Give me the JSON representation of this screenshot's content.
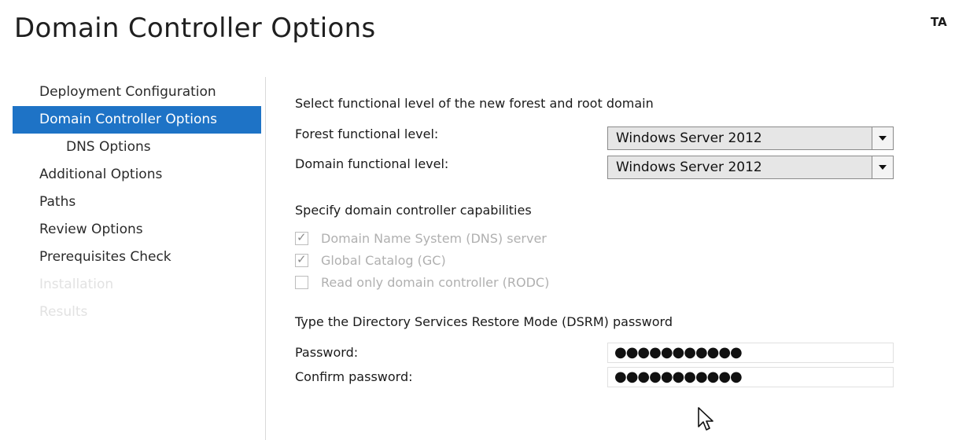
{
  "header": {
    "title": "Domain Controller Options",
    "server_badge": "TA"
  },
  "sidebar": {
    "items": [
      {
        "label": "Deployment Configuration",
        "state": "normal"
      },
      {
        "label": "Domain Controller Options",
        "state": "active"
      },
      {
        "label": "DNS Options",
        "state": "normal"
      },
      {
        "label": "Additional Options",
        "state": "normal"
      },
      {
        "label": "Paths",
        "state": "normal"
      },
      {
        "label": "Review Options",
        "state": "normal"
      },
      {
        "label": "Prerequisites Check",
        "state": "normal"
      },
      {
        "label": "Installation",
        "state": "disabled"
      },
      {
        "label": "Results",
        "state": "disabled"
      }
    ],
    "active_color": "#1e73c6"
  },
  "functional_level": {
    "heading": "Select functional level of the new forest and root domain",
    "forest_label": "Forest functional level:",
    "forest_value": "Windows Server 2012",
    "domain_label": "Domain functional level:",
    "domain_value": "Windows Server 2012"
  },
  "capabilities": {
    "heading": "Specify domain controller capabilities",
    "options": [
      {
        "label": "Domain Name System (DNS) server",
        "checked": true,
        "enabled": false
      },
      {
        "label": "Global Catalog (GC)",
        "checked": true,
        "enabled": false
      },
      {
        "label": "Read only domain controller (RODC)",
        "checked": false,
        "enabled": false
      }
    ]
  },
  "dsrm": {
    "heading": "Type the Directory Services Restore Mode (DSRM) password",
    "password_label": "Password:",
    "password_value": "●●●●●●●●●●●",
    "confirm_label": "Confirm password:",
    "confirm_value": "●●●●●●●●●●●"
  },
  "icons": {
    "dropdown": "chevron-down-icon",
    "check": "checkmark-icon",
    "pointer": "mouse-cursor-icon"
  }
}
